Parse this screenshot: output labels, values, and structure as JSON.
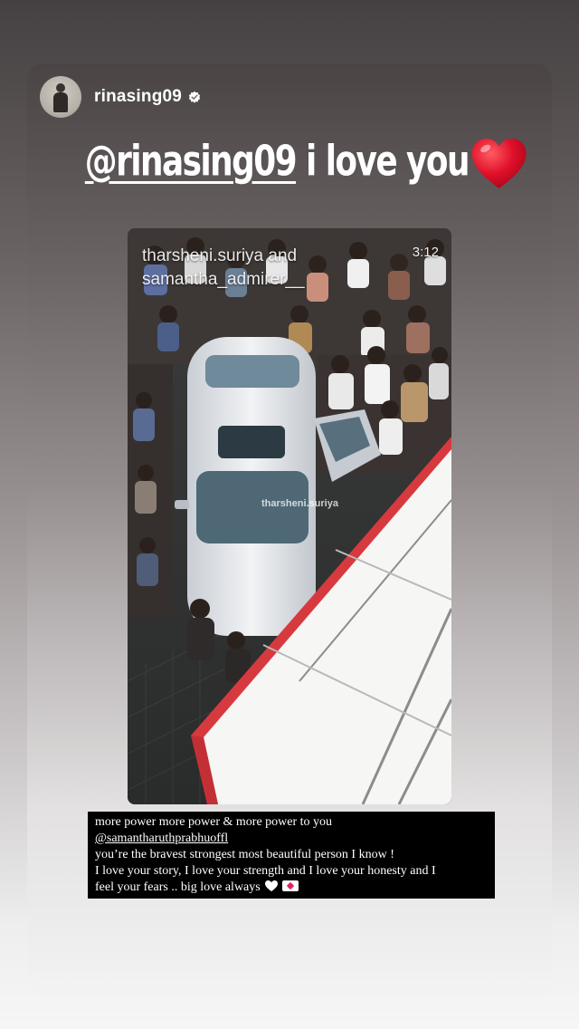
{
  "story": {
    "username": "rinasing09",
    "verified": true,
    "headline": {
      "mention": "@rinasing09",
      "text": " i love you",
      "emoji": "red-heart-icon"
    },
    "media": {
      "overlay_line1": "tharsheni.suriya and",
      "overlay_line2": "samantha_admirer__",
      "time": "3:12",
      "watermark": "tharsheni.suriya"
    },
    "caption": {
      "line1": "more power more power & more power to you",
      "line2": "@samantharuthprabhuoffl",
      "line3": "you’re the bravest strongest most beautiful person I know !",
      "line4": "I love your story, I love your strength and I love your honesty and I",
      "line5": "feel your fears .. big love always",
      "emojis": [
        "white-heart-icon",
        "love-letter-icon"
      ]
    }
  },
  "colors": {
    "heart_red": "#e0102a",
    "caption_bg": "#000000",
    "text_white": "#ffffff"
  }
}
